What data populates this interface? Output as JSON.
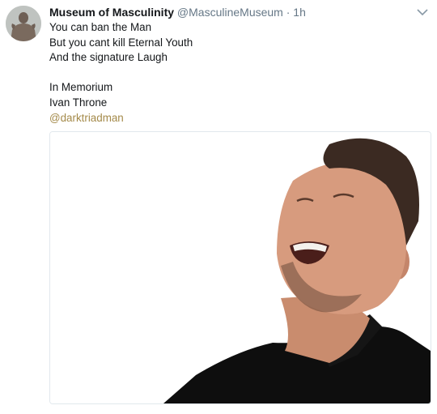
{
  "author": {
    "name": "Museum of Masculinity",
    "handle": "@MasculineMuseum",
    "separator": "·",
    "time": "1h"
  },
  "tweet": {
    "lines": [
      "You can ban the Man",
      "But you cant kill Eternal Youth",
      "And the signature Laugh",
      "",
      "In Memorium",
      "Ivan Throne"
    ],
    "mention": "@darktriadman"
  },
  "icons": {
    "avatar": "profile-avatar",
    "menu": "chevron-down-icon"
  },
  "colors": {
    "text": "#14171a",
    "secondary": "#657786",
    "mention": "#a48a4a",
    "border": "#e1e8ed"
  },
  "media": {
    "type": "photo",
    "subject": "laughing-man"
  }
}
